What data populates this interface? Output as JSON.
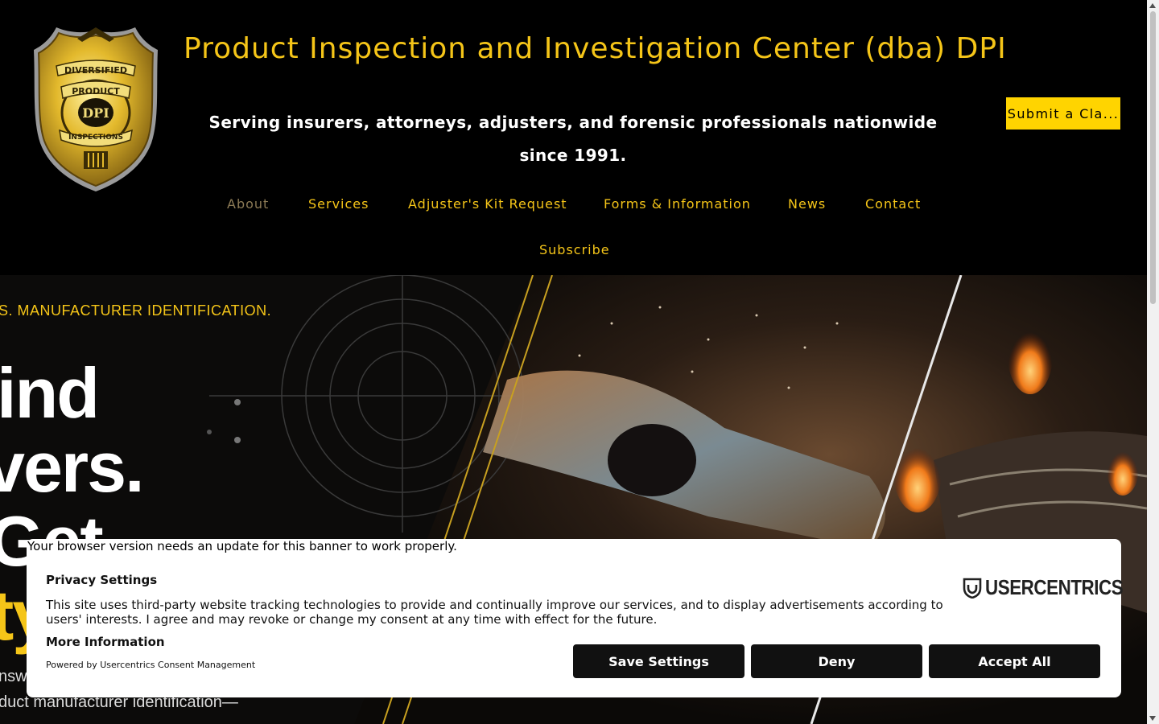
{
  "header": {
    "title": "Product Inspection and Investigation Center (dba) DPI",
    "tagline": "Serving insurers, attorneys, adjusters, and forensic professionals nationwide since 1991.",
    "cta_label": "Submit a Cla...",
    "logo": {
      "top_text": "DIVERSIFIED",
      "ribbon_text": "PRODUCT",
      "center_text": "DPI",
      "bottom_text": "INSPECTIONS"
    }
  },
  "nav": {
    "items": [
      {
        "label": "About"
      },
      {
        "label": "Services"
      },
      {
        "label": "Adjuster's Kit Request"
      },
      {
        "label": "Forms & Information"
      },
      {
        "label": "News"
      },
      {
        "label": "Contact"
      },
      {
        "label": "Subscribe"
      }
    ]
  },
  "hero": {
    "kicker": "S. MANUFACTURER IDENTIFICATION.",
    "line1": "ind",
    "line2": "vers.",
    "line3": "Get",
    "line4": "ty",
    "small1": "nsw",
    "small2": "duct manufacturer identification—"
  },
  "consent": {
    "browser_note": "Your browser version needs an update for this banner to work properly.",
    "title": "Privacy Settings",
    "body": "This site uses third-party website tracking technologies to provide and continually improve our services, and to display advertisements according to users' interests. I agree and may revoke or change my consent at any time with effect for the future.",
    "more_info": "More Information",
    "powered_by": "Powered by Usercentrics Consent Management",
    "brand": "USERCENTRICS",
    "buttons": {
      "save": "Save Settings",
      "deny": "Deny",
      "accept": "Accept All"
    }
  },
  "colors": {
    "accent": "#f5c518",
    "cta": "#ffd400",
    "muted_nav": "#8c7a55",
    "banner_button": "#111111"
  }
}
